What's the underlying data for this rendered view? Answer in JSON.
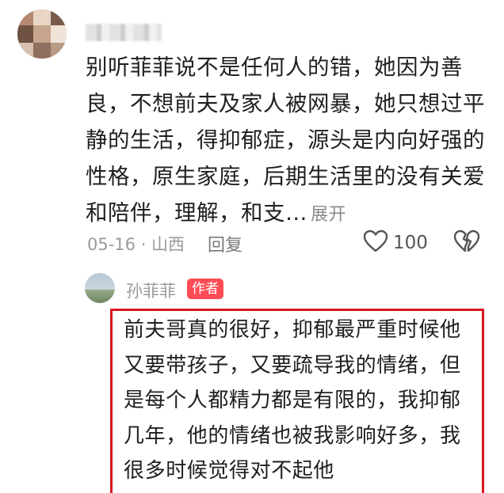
{
  "comment": {
    "lines": [
      "别听菲菲说不是任何人的错，她因为善",
      "良，不想前夫及家人被网暴，她只想过平",
      "静的生活，得抑郁症，源头是内向好强的",
      "性格，原生家庭，后期生活里的没有关爱",
      "和陪伴，理解，和支…"
    ],
    "expand_label": "展开",
    "meta": "05-16 · 山西",
    "reply_label": "回复",
    "like_count": "100"
  },
  "reply": {
    "author": "孙菲菲",
    "badge": "作者",
    "lines": [
      "前夫哥真的很好，抑郁最严重时候他",
      "又要带孩子，又要疏导我的情绪，但",
      "是每个人都精力都是有限的，我抑郁",
      "几年，他的情绪也被我影响好多，我",
      "很多时候觉得对不起他"
    ]
  },
  "colors": {
    "badge": "#ff4d56",
    "highlight_border": "#d9161f",
    "meta_text": "#9a9a9a"
  },
  "icons": {
    "like": "heart-outline-icon",
    "dislike": "broken-heart-icon"
  }
}
